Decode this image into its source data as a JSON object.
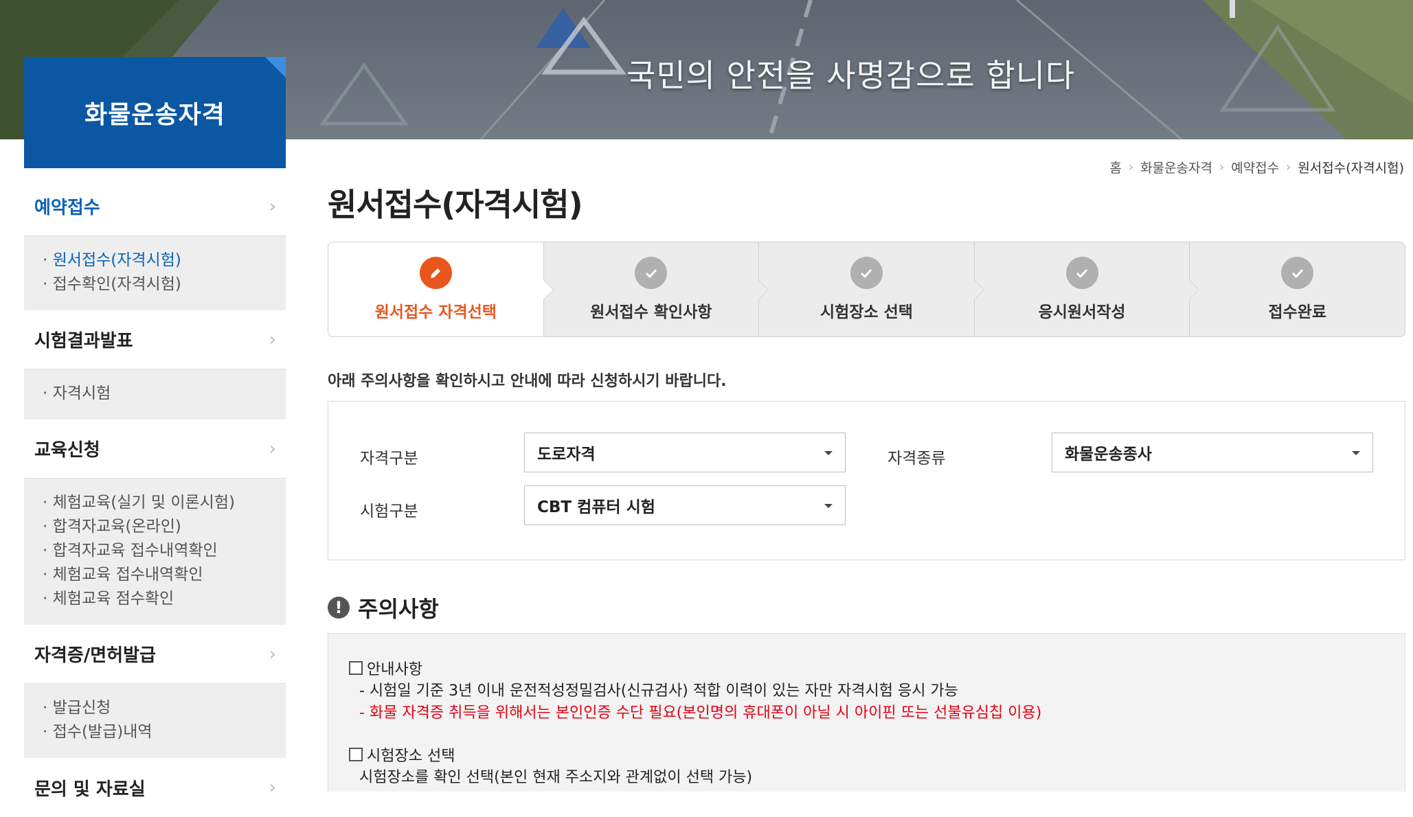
{
  "banner": {
    "slogan": "국민의 안전을 사명감으로 합니다"
  },
  "sidebar": {
    "title": "화물운송자격",
    "groups": [
      {
        "label": "예약접수",
        "chevron": "›",
        "items": [
          "원서접수(자격시험)",
          "접수확인(자격시험)"
        ]
      },
      {
        "label": "시험결과발표",
        "chevron": "›",
        "items": [
          "자격시험"
        ]
      },
      {
        "label": "교육신청",
        "chevron": "›",
        "items": [
          "체험교육(실기 및 이론시험)",
          "합격자교육(온라인)",
          "합격자교육 접수내역확인",
          "체험교육 접수내역확인",
          "체험교육 점수확인"
        ]
      },
      {
        "label": "자격증/면허발급",
        "chevron": "›",
        "items": [
          "발급신청",
          "접수(발급)내역"
        ]
      },
      {
        "label": "문의 및 자료실",
        "chevron": "›",
        "items": []
      }
    ]
  },
  "breadcrumb": [
    "홈",
    "화물운송자격",
    "예약접수",
    "원서접수(자격시험)"
  ],
  "breadcrumb_sep": "›",
  "page_title": "원서접수(자격시험)",
  "steps": [
    {
      "label": "원서접수 자격선택",
      "icon": "pencil-icon",
      "active": true
    },
    {
      "label": "원서접수 확인사항",
      "icon": "check-icon",
      "active": false
    },
    {
      "label": "시험장소 선택",
      "icon": "check-icon",
      "active": false
    },
    {
      "label": "응시원서작성",
      "icon": "check-icon",
      "active": false
    },
    {
      "label": "접수완료",
      "icon": "check-icon",
      "active": false
    }
  ],
  "notice": "아래 주의사항을 확인하시고 안내에 따라 신청하시기 바랍니다.",
  "form": {
    "qual_category": {
      "label": "자격구분",
      "value": "도로자격"
    },
    "qual_type": {
      "label": "자격종류",
      "value": "화물운송종사"
    },
    "exam_type": {
      "label": "시험구분",
      "value": "CBT 컴퓨터 시험"
    }
  },
  "warnings": {
    "title": "주의사항",
    "icon_glyph": "!",
    "guide": {
      "label": "안내사항",
      "line1": "- 시험일 기준 3년 이내 운전적성정밀검사(신규검사) 적합 이력이 있는 자만 자격시험 응시 가능",
      "line2": "- 화물 자격증 취득을 위해서는 본인인증 수단 필요(본인명의 휴대폰이 아닐 시 아이핀 또는 선불유심칩 이용)"
    },
    "venue": {
      "label": "시험장소 선택",
      "line1": "시험장소를 확인 선택(본인 현재 주소지와 관계없이 선택 가능)"
    }
  },
  "colors": {
    "brand_blue": "#0b57a4",
    "active_orange": "#e8561e",
    "warning_red": "#e60012"
  }
}
